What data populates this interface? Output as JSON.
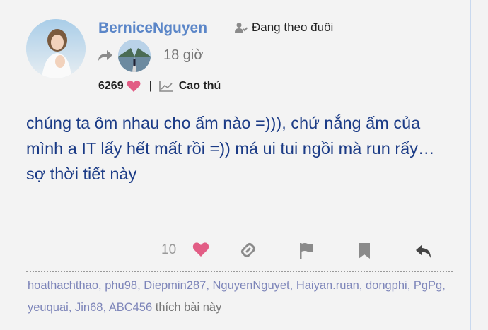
{
  "post": {
    "username": "BerniceNguyen",
    "follow_status": "Đang theo đuôi",
    "time": "18 giờ",
    "points": "6269",
    "rank": "Cao thủ",
    "body": "chúng ta ôm nhau cho ấm nào =))), chứ nắng ấm của mình a IT lấy hết mất rồi =)) má ui tui ngồi mà run rẩy…sợ thời tiết này"
  },
  "actions": {
    "like_count": "10"
  },
  "likers": {
    "names": [
      "hoathachthao",
      "phu98",
      "Diepmin287",
      "NguyenNguyet",
      "Haiyan.ruan",
      "dongphi",
      "PgPg",
      "yeuquai",
      "Jin68",
      "ABC456"
    ],
    "suffix": "thích bài này"
  },
  "colors": {
    "username": "#5b86c8",
    "body_text": "#1b3b86",
    "heart": "#e25d85",
    "liker_link": "#7d85b9",
    "icon_gray": "#8a8a8a"
  },
  "icons": [
    "user-follow-icon",
    "reply-arrow-icon",
    "heart-icon",
    "trend-icon",
    "link-icon",
    "flag-icon",
    "bookmark-icon",
    "reply-icon"
  ]
}
